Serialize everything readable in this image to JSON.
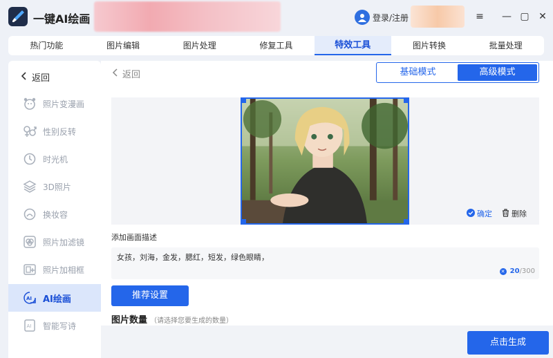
{
  "app": {
    "title": "一键AI绘画",
    "logo_icon": "brush-icon"
  },
  "header": {
    "login_label": "登录/注册",
    "window": {
      "menu": "≡",
      "minimize": "—",
      "maximize": "▢",
      "close": "✕"
    }
  },
  "tabs": [
    {
      "label": "热门功能",
      "active": false
    },
    {
      "label": "图片编辑",
      "active": false
    },
    {
      "label": "图片处理",
      "active": false
    },
    {
      "label": "修复工具",
      "active": false
    },
    {
      "label": "特效工具",
      "active": true
    },
    {
      "label": "图片转换",
      "active": false
    },
    {
      "label": "批量处理",
      "active": false
    }
  ],
  "sidebar": {
    "back_label": "返回",
    "items": [
      {
        "label": "照片变漫画",
        "icon": "cartoon-face-icon"
      },
      {
        "label": "性别反转",
        "icon": "gender-icon"
      },
      {
        "label": "时光机",
        "icon": "clock-icon"
      },
      {
        "label": "3D照片",
        "icon": "layers-icon"
      },
      {
        "label": "换妆容",
        "icon": "makeup-icon"
      },
      {
        "label": "照片加滤镜",
        "icon": "filter-icon"
      },
      {
        "label": "照片加相框",
        "icon": "frame-icon"
      },
      {
        "label": "AI绘画",
        "icon": "ai-paint-icon",
        "active": true
      },
      {
        "label": "智能写诗",
        "icon": "ai-poem-icon"
      }
    ]
  },
  "main": {
    "back_label": "返回",
    "modes": [
      {
        "label": "基础模式",
        "active": false
      },
      {
        "label": "高级模式",
        "active": true
      }
    ],
    "preview": {
      "confirm_label": "确定",
      "delete_label": "删除"
    },
    "description": {
      "label": "添加画面描述",
      "value": "女孩，刘海，金发，腮红，短发，绿色眼睛，",
      "count_current": "20",
      "count_max": "/300"
    },
    "recommend_button": "推荐设置",
    "count_label": "图片数量",
    "count_hint": "（请选择您要生成的数量）",
    "generate_button": "点击生成"
  },
  "colors": {
    "accent": "#2466ea",
    "sidebar_active_bg": "#dbe6fb",
    "page_bg": "#eef1f7"
  }
}
